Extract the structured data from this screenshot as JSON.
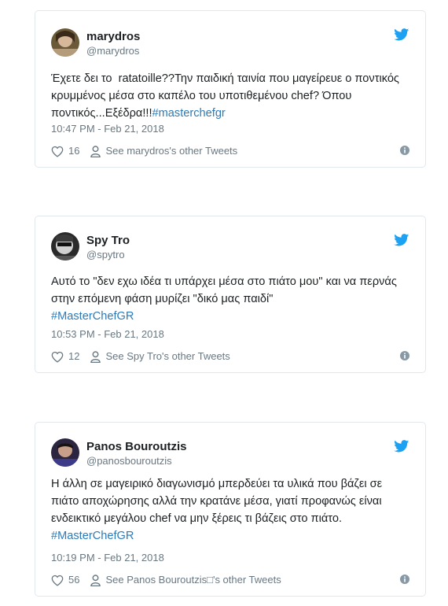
{
  "tweets": [
    {
      "name": "marydros",
      "handle": "@marydros",
      "text": "Έχετε δει το  ratatoille??Την παιδική ταινία που μαγείρευε ο ποντικός κρυμμένος μέσα στο καπέλο του υποτιθεμένου chef? Όπου ποντικός...Εξέδρα!!!",
      "hashtag": "#masterchefgr",
      "time": "10:47 PM - Feb 21, 2018",
      "likes": "16",
      "other": "See marydros's other Tweets"
    },
    {
      "name": "Spy Tro",
      "handle": "@spytro",
      "text": "Αυτό το \"δεν εχω ιδέα τι υπάρχει μέσα στο πιάτο μου\" και να περνάς στην επόμενη φάση μυρίζει \"δικό μας παιδί\"\n",
      "hashtag": "#MasterChefGR",
      "time": "10:53 PM - Feb 21, 2018",
      "likes": "12",
      "other": "See Spy Tro's other Tweets"
    },
    {
      "name": "Panos Bouroutzis",
      "handle": "@panosbouroutzis",
      "text": "Η άλλη σε μαγειρικό διαγωνισμό μπερδεύει τα υλικά που βάζει σε πιάτο αποχώρησης αλλά την κρατάνε μέσα, γιατί προφανώς είναι ενδεικτικό μεγάλου chef να μην ξέρεις τι βάζεις στο πιάτο.\n",
      "hashtag": "#MasterChefGR",
      "time": "10:19 PM - Feb 21, 2018",
      "likes": "56",
      "other": "See Panos Bouroutzis□'s other Tweets"
    }
  ],
  "colors": {
    "brand": "#1da1f2",
    "link": "#2b7bb9",
    "muted": "#697882"
  },
  "icons": {
    "bird": "twitter-bird-icon",
    "heart": "heart-icon",
    "person": "person-icon",
    "info": "info-icon"
  }
}
